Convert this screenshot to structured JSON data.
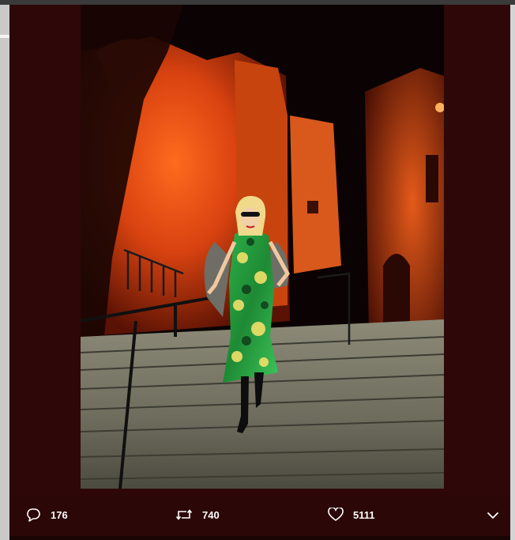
{
  "photo": {
    "alt": ""
  },
  "actions": {
    "reply": {
      "icon": "reply-icon",
      "count": "176"
    },
    "retweet": {
      "icon": "retweet-icon",
      "count": "740"
    },
    "like": {
      "icon": "heart-icon",
      "count": "5111"
    },
    "more": {
      "icon": "chevron-down-icon"
    }
  },
  "colors": {
    "background": "#2e0808",
    "icon": "#ffffff",
    "wall_glow": "#e04a12"
  }
}
